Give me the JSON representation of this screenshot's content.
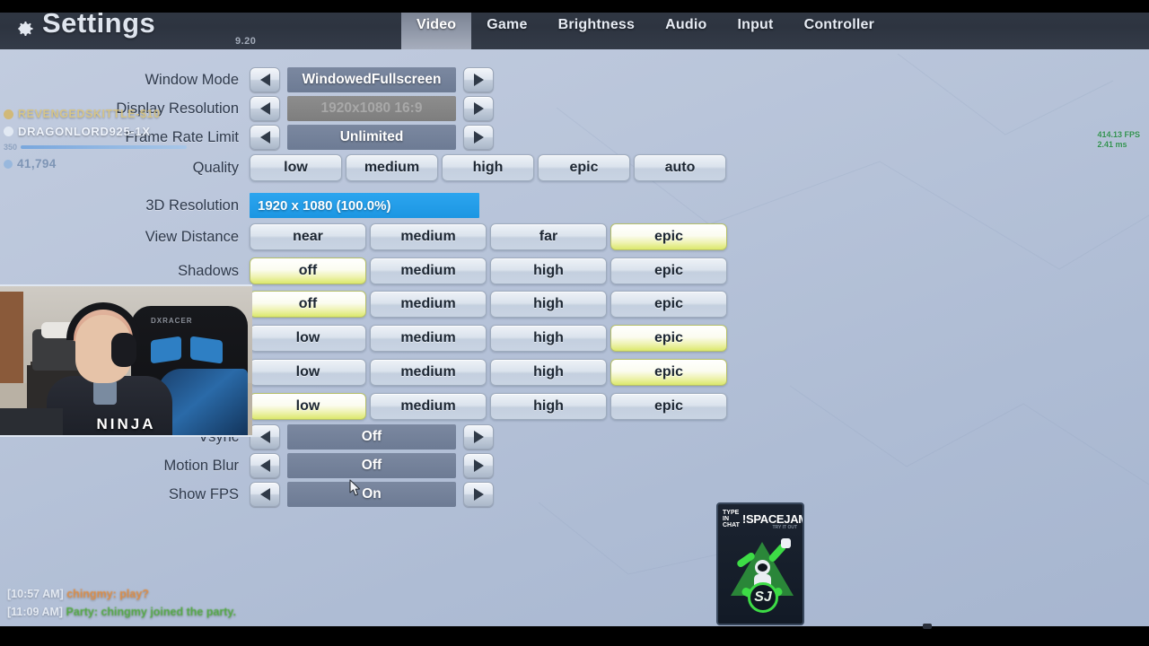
{
  "header": {
    "title": "Settings",
    "subtitle": "9.20",
    "gear_icon": "gear-icon",
    "tabs": [
      {
        "label": "Video",
        "active": true
      },
      {
        "label": "Game",
        "active": false
      },
      {
        "label": "Brightness",
        "active": false
      },
      {
        "label": "Audio",
        "active": false
      },
      {
        "label": "Input",
        "active": false
      },
      {
        "label": "Controller",
        "active": false
      }
    ]
  },
  "settings": {
    "window_mode": {
      "label": "Window Mode",
      "value": "WindowedFullscreen",
      "disabled": false
    },
    "display_resolution": {
      "label": "Display Resolution",
      "value": "1920x1080 16:9",
      "disabled": true
    },
    "frame_rate_limit": {
      "label": "Frame Rate Limit",
      "value": "Unlimited",
      "disabled": false
    },
    "quality": {
      "label": "Quality",
      "options": [
        "low",
        "medium",
        "high",
        "epic",
        "auto"
      ],
      "selected": -1
    },
    "three_d_resolution": {
      "label": "3D Resolution",
      "value": "1920 x 1080 (100.0%)",
      "percent": 100
    },
    "view_distance": {
      "label": "View Distance",
      "options": [
        "near",
        "medium",
        "far",
        "epic"
      ],
      "selected": 3
    },
    "shadows": {
      "label": "Shadows",
      "options": [
        "off",
        "medium",
        "high",
        "epic"
      ],
      "selected": 0
    },
    "anti_aliasing": {
      "label": "",
      "options": [
        "off",
        "medium",
        "high",
        "epic"
      ],
      "selected": 0
    },
    "textures": {
      "label": "",
      "options": [
        "low",
        "medium",
        "high",
        "epic"
      ],
      "selected": 3
    },
    "effects": {
      "label": "",
      "options": [
        "low",
        "medium",
        "high",
        "epic"
      ],
      "selected": 3
    },
    "post_processing": {
      "label": "",
      "options": [
        "low",
        "medium",
        "high",
        "epic"
      ],
      "selected": 0
    },
    "vsync": {
      "label": "Vsync",
      "value": "Off",
      "disabled": false
    },
    "motion_blur": {
      "label": "Motion Blur",
      "value": "Off",
      "disabled": false
    },
    "show_fps": {
      "label": "Show FPS",
      "value": "On",
      "disabled": false
    }
  },
  "overlay": {
    "donation_1": "REVENGEDSKITTLE-$10",
    "donation_2": "DRAGONLORD925-1X",
    "goal_count": "350",
    "points": "41,794",
    "webcam_name": "NINJA"
  },
  "fps_counter": {
    "fps": "414.13 FPS",
    "frametime": "2.41 ms"
  },
  "chat": [
    {
      "time": "[10:57 AM]",
      "text": "chingmy: play?",
      "color": "orange"
    },
    {
      "time": "[11:09 AM]",
      "text": "Party: chingmy joined the party.",
      "color": "green"
    }
  ],
  "ad": {
    "type_label_1": "TYPE",
    "type_label_2": "IN CHAT",
    "title": "!SPACEJAM",
    "subtitle": "TRY IT OUT",
    "logo": "SJ"
  },
  "colors": {
    "accent_blue": "#1c96e2",
    "selected_yellow": "#dbe86b",
    "header_dark": "#2d3440",
    "fps_green": "#2f8f4f"
  }
}
